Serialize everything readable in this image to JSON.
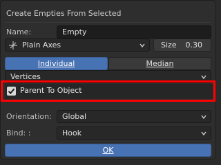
{
  "dialog": {
    "title": "Create Empties From Selected"
  },
  "name_row": {
    "label": "Name:",
    "value": "Empty"
  },
  "display_row": {
    "type_value": "Plain Axes",
    "type_icon": "plain-axes-icon",
    "size_label": "Size",
    "size_value": "0.30"
  },
  "mode_tabs": [
    {
      "label": "Individual",
      "selected": true
    },
    {
      "label": "Median",
      "selected": false
    }
  ],
  "source_dropdown": {
    "value": "Vertices"
  },
  "parent_checkbox": {
    "label": "Parent To Object",
    "checked": true
  },
  "orientation_row": {
    "label": "Orientation:",
    "value": "Global"
  },
  "bind_row": {
    "label": "Bind: :",
    "value": "Hook"
  },
  "ok_button": {
    "label": "OK"
  },
  "colors": {
    "accent": "#4772b3",
    "highlight": "#ff0000",
    "background": "#2e2e2e"
  }
}
